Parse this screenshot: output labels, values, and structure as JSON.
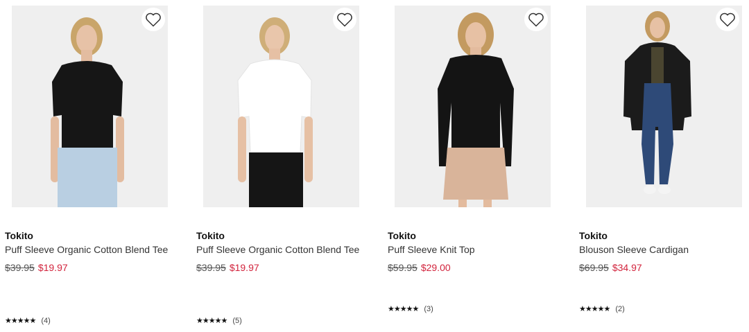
{
  "products": [
    {
      "brand": "Tokito",
      "name": "Puff Sleeve Organic Cotton Blend Tee",
      "was_price": "$39.95",
      "now_price": "$19.97",
      "rating_stars": 5,
      "review_count": "(4)",
      "image": {
        "top_color": "#161616",
        "bottom_color": "#b9cfe2",
        "background": "#efefef"
      }
    },
    {
      "brand": "Tokito",
      "name": "Puff Sleeve Organic Cotton Blend Tee",
      "was_price": "$39.95",
      "now_price": "$19.97",
      "rating_stars": 5,
      "review_count": "(5)",
      "image": {
        "top_color": "#ffffff",
        "bottom_color": "#151515",
        "background": "#efefef"
      }
    },
    {
      "brand": "Tokito",
      "name": "Puff Sleeve Knit Top",
      "was_price": "$59.95",
      "now_price": "$29.00",
      "rating_stars": 5,
      "review_count": "(3)",
      "image": {
        "top_color": "#141414",
        "bottom_color": "#d9b49a",
        "background": "#efefef"
      }
    },
    {
      "brand": "Tokito",
      "name": "Blouson Sleeve Cardigan",
      "was_price": "$69.95",
      "now_price": "$34.97",
      "rating_stars": 5,
      "review_count": "(2)",
      "image": {
        "top_color": "#1b1b1b",
        "bottom_color": "#2e4a78",
        "background": "#efefef"
      }
    }
  ],
  "colors": {
    "sale_price": "#d2233c",
    "card_bg": "#efefef"
  },
  "icons": {
    "wishlist": "heart-outline-icon",
    "rating": "star-icon"
  }
}
